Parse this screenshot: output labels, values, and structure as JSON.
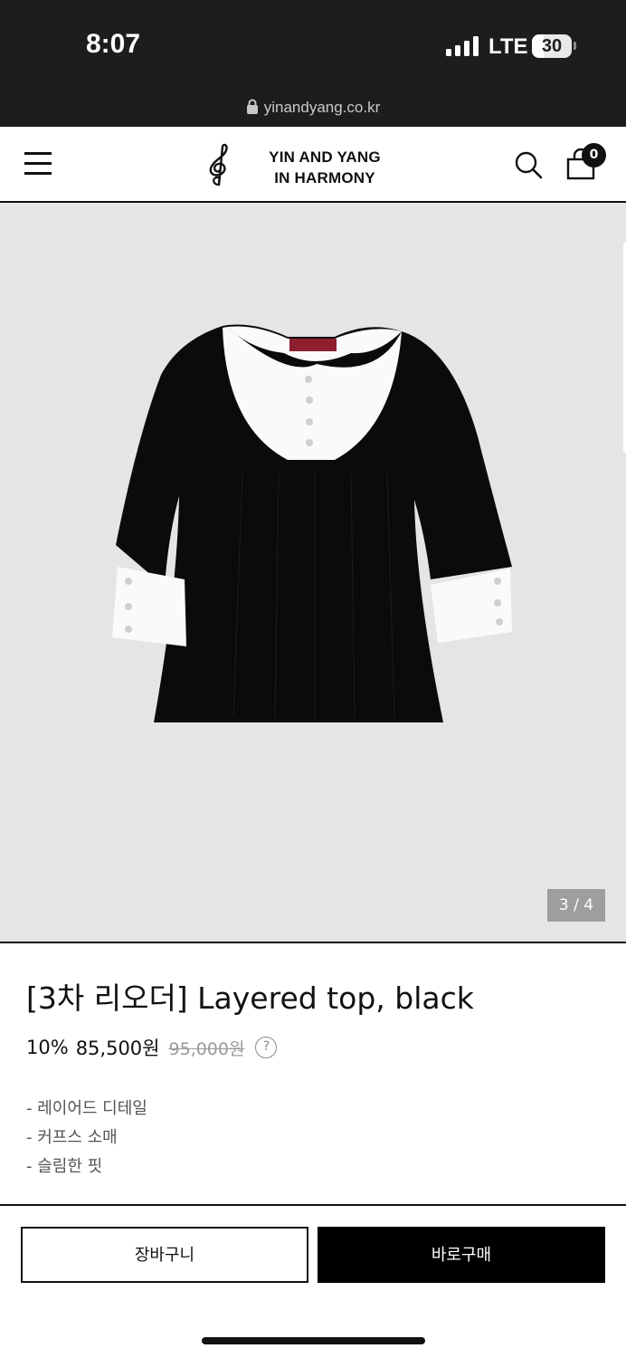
{
  "status_bar": {
    "time": "8:07",
    "network": "LTE",
    "battery": "30",
    "url": "yinandyang.co.kr"
  },
  "header": {
    "logo_line1": "YIN AND YANG",
    "logo_line2": "IN HARMONY",
    "cart_count": "0",
    "icons": [
      "menu-icon",
      "treble-clef-logo",
      "search-icon",
      "shopping-bag-icon",
      "lock-icon"
    ]
  },
  "gallery": {
    "counter": "3 / 4",
    "current_index": 3,
    "total": 4,
    "background_color": "#e5e5e6"
  },
  "product": {
    "title": "[3차 리오더] Layered top, black",
    "discount": "10%",
    "sale_price": "85,500원",
    "original_price": "95,000원",
    "help": "?",
    "description": [
      "- 레이어드 디테일",
      "- 커프스 소매",
      "- 슬림한 핏"
    ]
  },
  "actions": {
    "add_to_cart": "장바구니",
    "buy_now": "바로구매"
  },
  "colors": {
    "status_bar": "#1c1d1f",
    "primary": "#000000",
    "muted_text": "#555555",
    "strike_price": "#9a9a9a"
  }
}
